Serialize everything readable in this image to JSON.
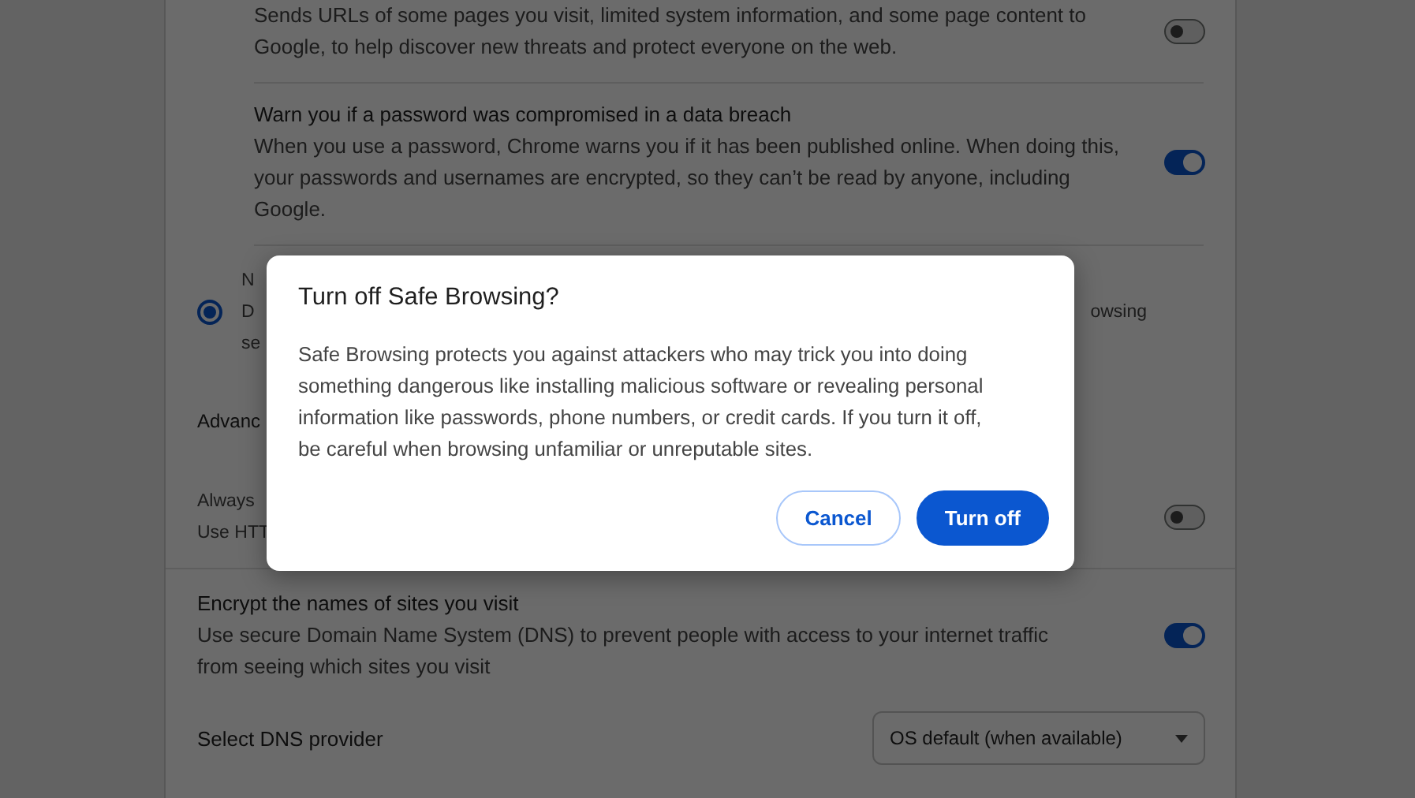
{
  "rows": [
    {
      "kind": "toggle",
      "text": "Sends URLs of some pages you visit, limited system information, and some page content to Google, to help discover new threats and protect everyone on the web.",
      "on": false
    },
    {
      "kind": "toggle",
      "title": "Warn you if a password was compromised in a data breach",
      "text": "When you use a password, Chrome warns you if it has been published online. When doing this, your passwords and usernames are encrypted, so they can’t be read by anyone, including Google.",
      "on": true
    },
    {
      "kind": "radio",
      "selected": true,
      "fragments": [
        {
          "left": "N"
        },
        {
          "left": "D",
          "right": "owsing"
        },
        {
          "left": "se"
        }
      ]
    },
    {
      "kind": "heading",
      "text": "Advanc"
    },
    {
      "kind": "toggle",
      "fragments": [
        {
          "left": "Always"
        },
        {
          "left": "Use HTT"
        }
      ],
      "on": false
    },
    {
      "kind": "toggle",
      "title": "Encrypt the names of sites you visit",
      "text": "Use secure Domain Name System (DNS) to prevent people with access to your internet traffic from seeing which sites you visit",
      "on": true
    },
    {
      "kind": "select",
      "label": "Select DNS provider",
      "value": "OS default (when available)"
    }
  ],
  "dialog": {
    "title": "Turn off Safe Browsing?",
    "body": "Safe Browsing protects you against attackers who may trick you into doing something dangerous like installing malicious software or revealing personal information like passwords, phone numbers, or credit cards. If you turn it off, be careful when browsing unfamiliar or unreputable sites.",
    "buttons": [
      {
        "label": "Cancel",
        "kind": "secondary"
      },
      {
        "label": "Turn off",
        "kind": "primary"
      }
    ]
  }
}
